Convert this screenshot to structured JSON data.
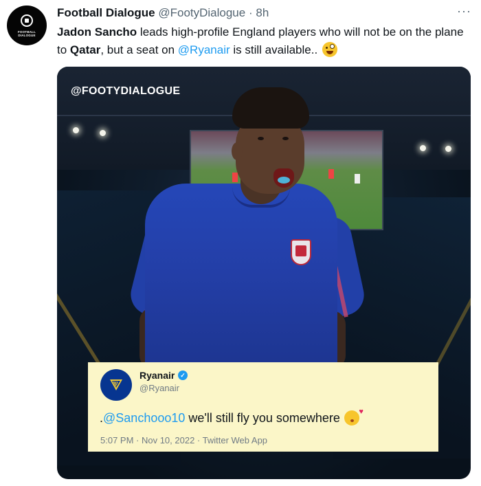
{
  "tweet": {
    "author_name": "Football Dialogue",
    "author_handle": "@FootyDialogue",
    "separator": "·",
    "time_ago": "8h",
    "more_label": "···",
    "avatar_text": "FOOTBALL DIALOGUE",
    "avatar_subtext": "FOOTBALL DIALOGUE",
    "text": {
      "bold_1": "Jadon Sancho",
      "part_1": " leads high-profile England players who will not be on the plane to ",
      "bold_2": "Qatar",
      "part_2": ", but a seat on ",
      "mention": "@Ryanair",
      "part_3": " is still available.. ",
      "emoji": "zany-face-emoji"
    }
  },
  "media": {
    "watermark": "@FOOTYDIALOGUE",
    "embedded_tweet": {
      "name": "Ryanair",
      "handle": "@Ryanair",
      "verified_icon": "verified-check-icon",
      "text_prefix": ".",
      "mention": "@Sanchooo10",
      "text": " we'll still fly you somewhere",
      "emoji": "face-blowing-kiss-emoji",
      "meta": "5:07 PM · Nov 10, 2022 · Twitter Web App"
    }
  },
  "colors": {
    "link": "#1d9bf0",
    "card_background": "#fbf6c8",
    "ryanair_blue": "#073590",
    "secondary_text": "#536471"
  }
}
